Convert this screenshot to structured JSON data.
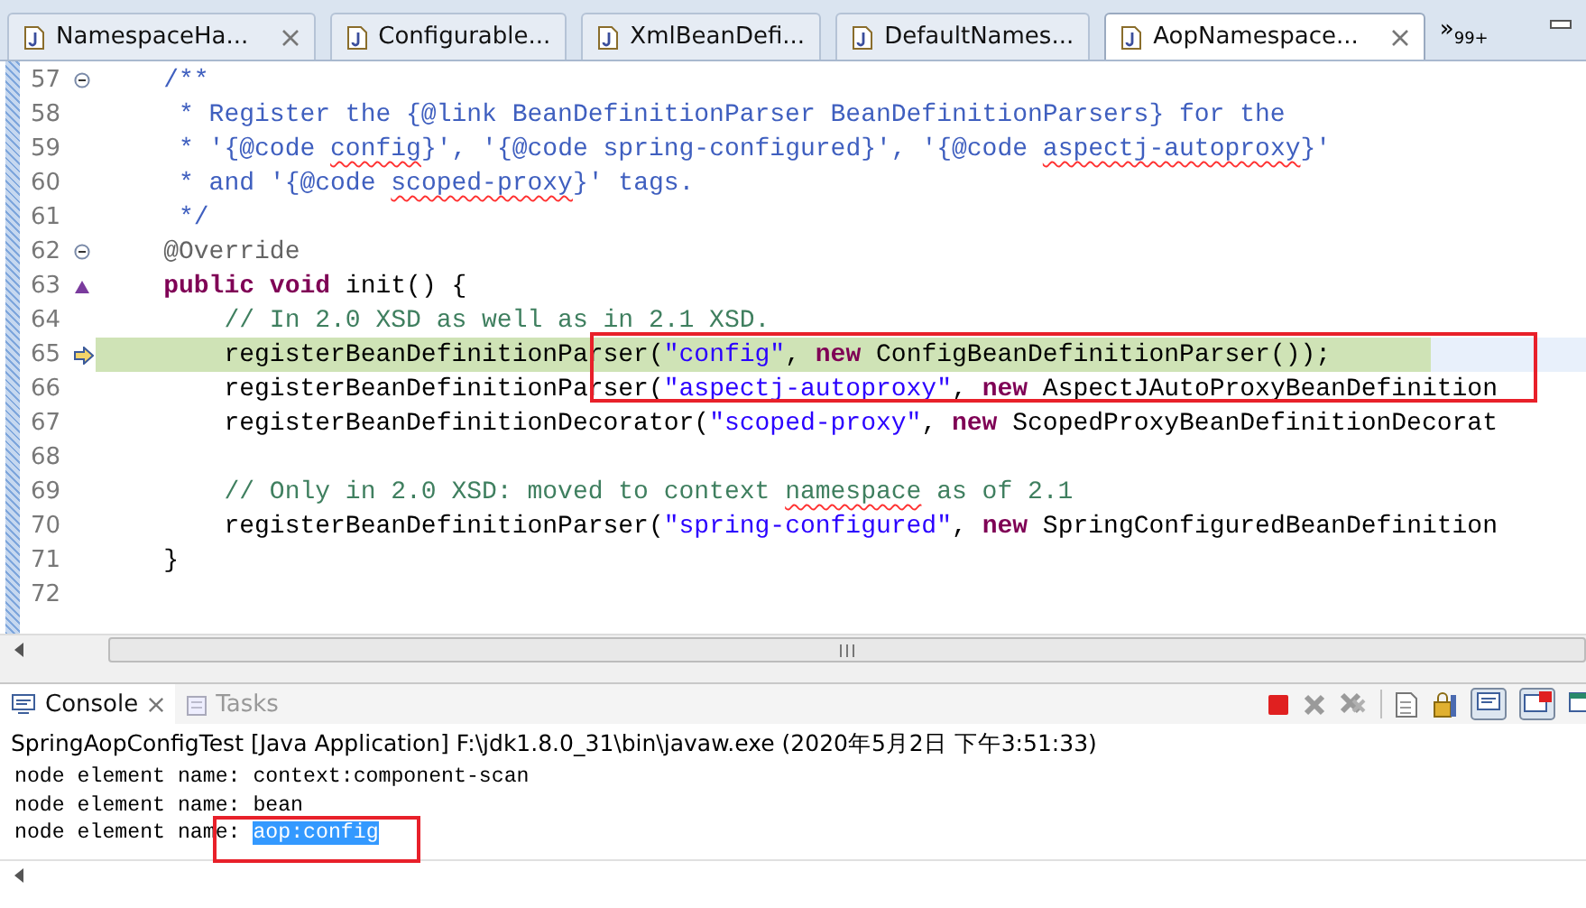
{
  "editor_tabs": [
    {
      "label": "NamespaceHa...",
      "selected": false,
      "closable": true
    },
    {
      "label": "Configurable...",
      "selected": false,
      "closable": false
    },
    {
      "label": "XmlBeanDefi...",
      "selected": false,
      "closable": false
    },
    {
      "label": "DefaultNames...",
      "selected": false,
      "closable": false
    },
    {
      "label": "AopNamespace...",
      "selected": true,
      "closable": true
    }
  ],
  "overflow_tabs": {
    "label": "»",
    "count": "99+"
  },
  "editor": {
    "lines": [
      {
        "number": "57",
        "collapsible": true,
        "override_marker": false,
        "execution_arrow": false,
        "current": false,
        "tokens": [
          {
            "kind": "javadoc",
            "text": "    /**"
          }
        ]
      },
      {
        "number": "58",
        "collapsible": false,
        "override_marker": false,
        "execution_arrow": false,
        "current": false,
        "tokens": [
          {
            "kind": "javadoc",
            "text": "     * Register the {@link BeanDefinitionParser BeanDefinitionParsers} for the"
          }
        ]
      },
      {
        "number": "59",
        "collapsible": false,
        "override_marker": false,
        "execution_arrow": false,
        "current": false,
        "tokens": [
          {
            "kind": "javadoc",
            "text": "     * '{@code "
          },
          {
            "kind": "javadoc-misspelled",
            "text": "config"
          },
          {
            "kind": "javadoc",
            "text": "}', '{@code spring-configured}', '{@code "
          },
          {
            "kind": "javadoc-misspelled",
            "text": "aspectj-autoproxy"
          },
          {
            "kind": "javadoc",
            "text": "}'"
          }
        ]
      },
      {
        "number": "60",
        "collapsible": false,
        "override_marker": false,
        "execution_arrow": false,
        "current": false,
        "tokens": [
          {
            "kind": "javadoc",
            "text": "     * and '{@code "
          },
          {
            "kind": "javadoc-misspelled",
            "text": "scoped-proxy"
          },
          {
            "kind": "javadoc",
            "text": "}' tags."
          }
        ]
      },
      {
        "number": "61",
        "collapsible": false,
        "override_marker": false,
        "execution_arrow": false,
        "current": false,
        "tokens": [
          {
            "kind": "javadoc",
            "text": "     */"
          }
        ]
      },
      {
        "number": "62",
        "collapsible": true,
        "override_marker": false,
        "execution_arrow": false,
        "current": false,
        "tokens": [
          {
            "kind": "annotation",
            "text": "    @Override"
          }
        ]
      },
      {
        "number": "63",
        "collapsible": false,
        "override_marker": true,
        "execution_arrow": false,
        "current": false,
        "tokens": [
          {
            "kind": "keyword",
            "text": "    public void"
          },
          {
            "kind": "plain",
            "text": " init() {"
          }
        ]
      },
      {
        "number": "64",
        "collapsible": false,
        "override_marker": false,
        "execution_arrow": false,
        "current": false,
        "tokens": [
          {
            "kind": "comment",
            "text": "        // In 2.0 XSD as well as in 2.1 XSD."
          }
        ]
      },
      {
        "number": "65",
        "collapsible": false,
        "override_marker": false,
        "execution_arrow": true,
        "current": true,
        "tokens": [
          {
            "kind": "plain",
            "text": "        registerBeanDefinitionParser("
          },
          {
            "kind": "string",
            "text": "\"config\""
          },
          {
            "kind": "plain",
            "text": ", "
          },
          {
            "kind": "keyword",
            "text": "new"
          },
          {
            "kind": "plain",
            "text": " ConfigBeanDefinitionParser());"
          }
        ]
      },
      {
        "number": "66",
        "collapsible": false,
        "override_marker": false,
        "execution_arrow": false,
        "current": false,
        "tokens": [
          {
            "kind": "plain",
            "text": "        registerBeanDefinitionParser("
          },
          {
            "kind": "string",
            "text": "\"aspectj-autoproxy\""
          },
          {
            "kind": "plain",
            "text": ", "
          },
          {
            "kind": "keyword",
            "text": "new"
          },
          {
            "kind": "plain",
            "text": " AspectJAutoProxyBeanDefinition"
          }
        ]
      },
      {
        "number": "67",
        "collapsible": false,
        "override_marker": false,
        "execution_arrow": false,
        "current": false,
        "tokens": [
          {
            "kind": "plain",
            "text": "        registerBeanDefinitionDecorator("
          },
          {
            "kind": "string",
            "text": "\"scoped-proxy\""
          },
          {
            "kind": "plain",
            "text": ", "
          },
          {
            "kind": "keyword",
            "text": "new"
          },
          {
            "kind": "plain",
            "text": " ScopedProxyBeanDefinitionDecorat"
          }
        ]
      },
      {
        "number": "68",
        "collapsible": false,
        "override_marker": false,
        "execution_arrow": false,
        "current": false
      },
      {
        "number": "69",
        "collapsible": false,
        "override_marker": false,
        "execution_arrow": false,
        "current": false,
        "tokens": [
          {
            "kind": "comment",
            "text": "        // Only in 2.0 XSD: moved to context "
          },
          {
            "kind": "comment-misspelled",
            "text": "namespace"
          },
          {
            "kind": "comment",
            "text": " as of 2.1"
          }
        ]
      },
      {
        "number": "70",
        "collapsible": false,
        "override_marker": false,
        "execution_arrow": false,
        "current": false,
        "tokens": [
          {
            "kind": "plain",
            "text": "        registerBeanDefinitionParser("
          },
          {
            "kind": "string",
            "text": "\"spring-configured\""
          },
          {
            "kind": "plain",
            "text": ", "
          },
          {
            "kind": "keyword",
            "text": "new"
          },
          {
            "kind": "plain",
            "text": " SpringConfiguredBeanDefinition"
          }
        ]
      },
      {
        "number": "71",
        "collapsible": false,
        "override_marker": false,
        "execution_arrow": false,
        "current": false,
        "tokens": [
          {
            "kind": "plain",
            "text": "    }"
          }
        ]
      },
      {
        "number": "72",
        "collapsible": false,
        "override_marker": false,
        "execution_arrow": false,
        "current": false
      }
    ]
  },
  "console": {
    "tabs": [
      {
        "label": "Console",
        "selected": true
      },
      {
        "label": "Tasks",
        "selected": false
      }
    ],
    "title": "SpringAopConfigTest [Java Application] F:\\jdk1.8.0_31\\bin\\javaw.exe (2020年5月2日 下午3:51:33)",
    "output": [
      [
        {
          "text": "node element name: context:component-scan",
          "selected": false
        }
      ],
      [
        {
          "text": "node element name: bean",
          "selected": false
        }
      ],
      [
        {
          "text": "node element name: ",
          "selected": false
        },
        {
          "text": "aop:config",
          "selected": true
        }
      ]
    ]
  }
}
